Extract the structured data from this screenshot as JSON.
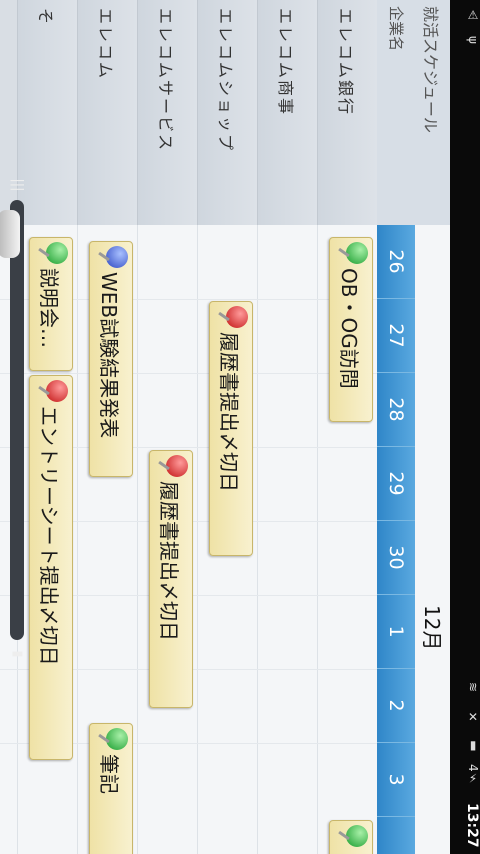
{
  "status_bar": {
    "time": "13:27",
    "icons": [
      "warning-icon",
      "usb-icon",
      "wifi-icon",
      "silent-icon",
      "signal-icon",
      "battery-charging-icon"
    ],
    "battery": "4"
  },
  "app": {
    "title": "就活スケジュール",
    "column_header": "企業名",
    "month": "12月",
    "days": [
      "26",
      "27",
      "28",
      "29",
      "30",
      "1",
      "2",
      "3"
    ],
    "companies": [
      "エレコム銀行",
      "エレコム商事",
      "エレコムショップ",
      "エレコムサービス",
      "エレコム",
      "そ"
    ],
    "events": [
      {
        "label": "OB・OG訪問",
        "pin": "green"
      },
      {
        "label": "履歴書提出〆切日",
        "pin": "red"
      },
      {
        "label": "履歴書提出〆切日",
        "pin": "red"
      },
      {
        "label": "WEB試験結果発表",
        "pin": "blue"
      },
      {
        "label": "説明会…",
        "pin": "green"
      },
      {
        "label": "エントリーシート提出〆切日",
        "pin": "red"
      },
      {
        "label": "筆記",
        "pin": "green"
      },
      {
        "label": "",
        "pin": "green"
      }
    ]
  }
}
